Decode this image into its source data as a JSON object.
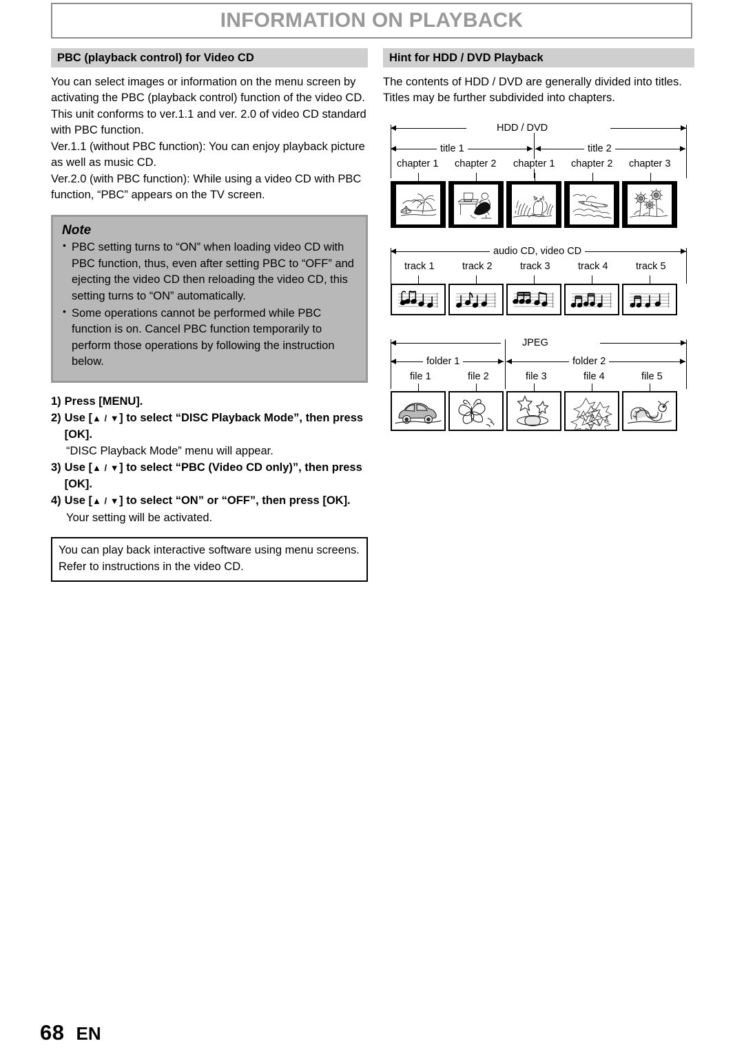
{
  "page": {
    "header_title": "INFORMATION ON PLAYBACK",
    "footer_page_number": "68",
    "footer_language": "EN"
  },
  "left_column": {
    "section_title": "PBC (playback control) for Video CD",
    "paragraphs": [
      "You can select images or information on the menu screen by activating the PBC (playback control) function of the video CD.",
      "This unit conforms to ver.1.1 and ver. 2.0 of video CD standard with PBC function.",
      "Ver.1.1 (without PBC function): You can enjoy playback picture as well as music CD.",
      "Ver.2.0 (with PBC function): While using a video CD with PBC function, “PBC” appears on the TV screen."
    ],
    "note": {
      "title": "Note",
      "items": [
        "PBC setting turns to “ON” when loading video CD with PBC function, thus, even after setting PBC to “OFF” and ejecting the video CD then reloading the video CD, this setting turns to “ON” automatically.",
        "Some operations cannot be performed while PBC function is on. Cancel PBC function temporarily to perform those operations by following the instruction below."
      ]
    },
    "steps": [
      {
        "num": "1)",
        "text": "Press [MENU].",
        "sub": ""
      },
      {
        "num": "2)",
        "text_pre": "Use [",
        "arrows": "▲ / ▼",
        "text_post": "] to select “DISC Playback Mode”, then press [OK].",
        "sub": "“DISC Playback Mode” menu will appear."
      },
      {
        "num": "3)",
        "text_pre": "Use [",
        "arrows": "▲ / ▼",
        "text_post": "] to select “PBC (Video CD only)”, then press [OK].",
        "sub": ""
      },
      {
        "num": "4)",
        "text_pre": "Use [",
        "arrows": "▲ / ▼",
        "text_post": "] to select “ON” or “OFF”, then press [OK].",
        "sub": "Your setting will be activated."
      }
    ],
    "callout": "You can play back interactive software using menu screens. Refer to instructions in the video CD."
  },
  "right_column": {
    "section_title": "Hint for HDD / DVD Playback",
    "intro": "The contents of HDD / DVD are generally divided into titles. Titles may be further subdivided into chapters.",
    "diagram_hdd": {
      "top_label": "HDD / DVD",
      "groups": [
        {
          "label": "title 1",
          "items": [
            "chapter 1",
            "chapter 2"
          ]
        },
        {
          "label": "title 2",
          "items": [
            "chapter 1",
            "chapter 2",
            "chapter 3"
          ]
        }
      ],
      "frames": [
        "beach-palm-tree-illustration",
        "person-at-desk-illustration",
        "cat-in-grass-illustration",
        "airplane-in-clouds-illustration",
        "sunflowers-illustration"
      ]
    },
    "diagram_cd": {
      "top_label": "audio CD, video CD",
      "items": [
        "track 1",
        "track 2",
        "track 3",
        "track 4",
        "track 5"
      ],
      "frames": [
        "music-notes-illustration",
        "music-notes-illustration",
        "music-notes-illustration",
        "music-notes-illustration",
        "music-notes-illustration"
      ]
    },
    "diagram_jpeg": {
      "top_label": "JPEG",
      "groups": [
        {
          "label": "folder 1",
          "items": [
            "file 1",
            "file 2"
          ]
        },
        {
          "label": "folder 2",
          "items": [
            "file 3",
            "file 4",
            "file 5"
          ]
        }
      ],
      "frames": [
        "car-illustration",
        "butterfly-illustration",
        "stars-and-planet-illustration",
        "flowers-illustration",
        "caterpillar-illustration"
      ]
    }
  },
  "colors": {
    "header_text": "#999999",
    "section_bar_bg": "#cfcfcf",
    "note_bg": "#b8b8b8",
    "note_border": "#999999"
  }
}
